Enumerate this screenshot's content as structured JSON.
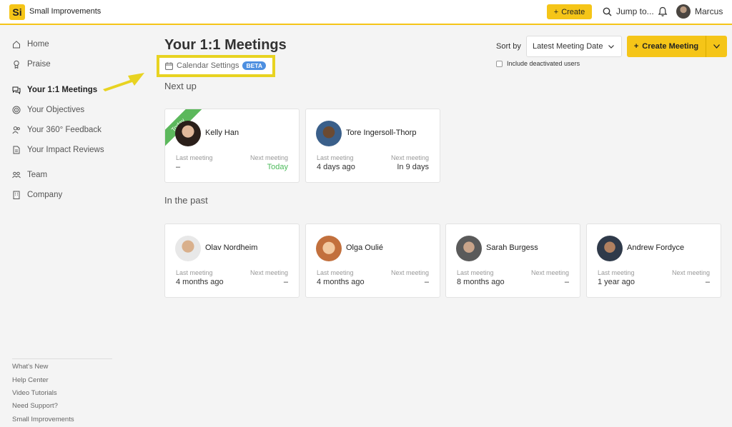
{
  "app": {
    "name": "Small Improvements",
    "logo_text": "Si"
  },
  "topbar": {
    "create_label": "Create",
    "jump_label": "Jump to...",
    "user_name": "Marcus"
  },
  "sidebar": {
    "items": [
      {
        "label": "Home",
        "icon": "home-icon"
      },
      {
        "label": "Praise",
        "icon": "praise-icon"
      },
      {
        "label": "Your 1:1 Meetings",
        "icon": "chat-icon",
        "active": true
      },
      {
        "label": "Your Objectives",
        "icon": "target-icon"
      },
      {
        "label": "Your 360° Feedback",
        "icon": "people-icon"
      },
      {
        "label": "Your Impact Reviews",
        "icon": "document-icon"
      },
      {
        "label": "Team",
        "icon": "team-icon"
      },
      {
        "label": "Company",
        "icon": "building-icon"
      }
    ],
    "footer": [
      "What's New",
      "Help Center",
      "Video Tutorials",
      "Need Support?",
      "Small Improvements"
    ]
  },
  "main": {
    "title": "Your 1:1 Meetings",
    "calendar_settings": "Calendar Settings",
    "beta_badge": "BETA",
    "sort_label": "Sort by",
    "sort_value": "Latest Meeting Date",
    "create_meeting": "Create Meeting",
    "include_deactivated": "Include deactivated users",
    "next_up_label": "Next up",
    "past_label": "In the past",
    "last_meeting_label": "Last meeting",
    "next_meeting_label": "Next meeting",
    "today_ribbon": "Today",
    "next_up": [
      {
        "name": "Kelly Han",
        "last": "–",
        "next": "Today"
      },
      {
        "name": "Tore Ingersoll-Thorp",
        "last": "4 days ago",
        "next": "In 9 days"
      }
    ],
    "past": [
      {
        "name": "Olav Nordheim",
        "last": "4 months ago",
        "next": "–"
      },
      {
        "name": "Olga Oulié",
        "last": "4 months ago",
        "next": "–"
      },
      {
        "name": "Sarah Burgess",
        "last": "8 months ago",
        "next": "–"
      },
      {
        "name": "Andrew Fordyce",
        "last": "1 year ago",
        "next": "–"
      }
    ]
  },
  "colors": {
    "accent": "#f5c518",
    "highlight_box": "#e8d321",
    "beta": "#4d8fe0",
    "today_green": "#4cbb5b"
  }
}
